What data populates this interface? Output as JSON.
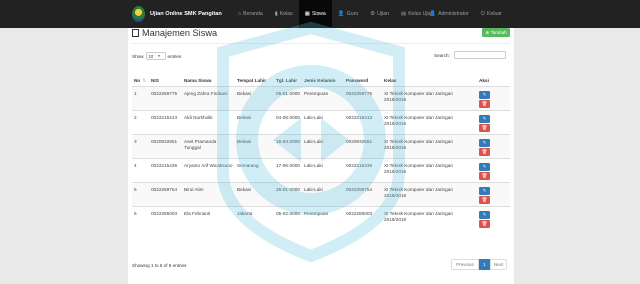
{
  "navbar": {
    "brand": "Ujian Online SMK Pangitan",
    "items": [
      {
        "icon": "⌂",
        "label": "Beranda",
        "active": false
      },
      {
        "icon": "▮",
        "label": "Kelas",
        "active": false
      },
      {
        "icon": "▦",
        "label": "Siswa",
        "active": true
      },
      {
        "icon": "👤",
        "label": "Guru",
        "active": false
      },
      {
        "icon": "⚙",
        "label": "Ujian",
        "active": false
      },
      {
        "icon": "▤",
        "label": "Kelas Ujian",
        "active": false
      }
    ],
    "right": [
      {
        "icon": "👤",
        "label": "Administrator"
      },
      {
        "icon": "⏻",
        "label": "Keluar"
      }
    ]
  },
  "page": {
    "title": "Manajemen Siswa",
    "add_button": "Tambah",
    "show_label": "Show",
    "entries_value": "10",
    "entries_label": "entries",
    "search_label": "Search:",
    "info": "Showing 1 to 6 of 6 entries",
    "pager": {
      "prev": "Previous",
      "current": "1",
      "next": "Next"
    }
  },
  "table": {
    "headers": [
      "No",
      "NIS",
      "Nama Siswa",
      "Tempat Lahir",
      "Tgl. Lahir",
      "Jenis Kelamin",
      "Password",
      "Kelas",
      "Aksi"
    ],
    "rows": [
      {
        "no": "1",
        "nis": "0022259775",
        "nama": "Ajeng Zahra Firdausi",
        "tempat": "Bekasi",
        "tgl": "05-01-2000",
        "jk": "Perempuan",
        "password": "0022259775",
        "kelas": "XI Teknik Komputer dan Jaringan 2018/2019"
      },
      {
        "no": "2",
        "nis": "0022215413",
        "nama": "Aldi Nurkholik",
        "tempat": "Bekasi",
        "tgl": "04-05-2000",
        "jk": "Laki-Laki",
        "password": "0022215413",
        "kelas": "XI Teknik Komputer dan Jaringan 2018/2019"
      },
      {
        "no": "3",
        "nis": "0020932651",
        "nama": "Aset Pramanda Tunggal",
        "tempat": "Bekasi",
        "tgl": "15-04-2000",
        "jk": "Laki-Laki",
        "password": "0020932651",
        "kelas": "XI Teknik Komputer dan Jaringan 2018/2019"
      },
      {
        "no": "4",
        "nis": "0022215436",
        "nama": "Aryanto Arif Wicaksono",
        "tempat": "Semarang",
        "tgl": "17-06-2000",
        "jk": "Laki-Laki",
        "password": "0022215436",
        "kelas": "XI Teknik Komputer dan Jaringan 2018/2019"
      },
      {
        "no": "5",
        "nis": "0022259754",
        "nama": "Birul Alim",
        "tempat": "Bekasi",
        "tgl": "25-01-2000",
        "jk": "Laki-Laki",
        "password": "0022259754",
        "kelas": "XI Teknik Komputer dan Jaringan 2018/2019"
      },
      {
        "no": "6",
        "nis": "0022285003",
        "nama": "Ela Febrianti",
        "tempat": "Jakarta",
        "tgl": "05-02-2000",
        "jk": "Perempuan",
        "password": "0022285003",
        "kelas": "XI Teknik Komputer dan Jaringan 2018/2019"
      }
    ]
  }
}
